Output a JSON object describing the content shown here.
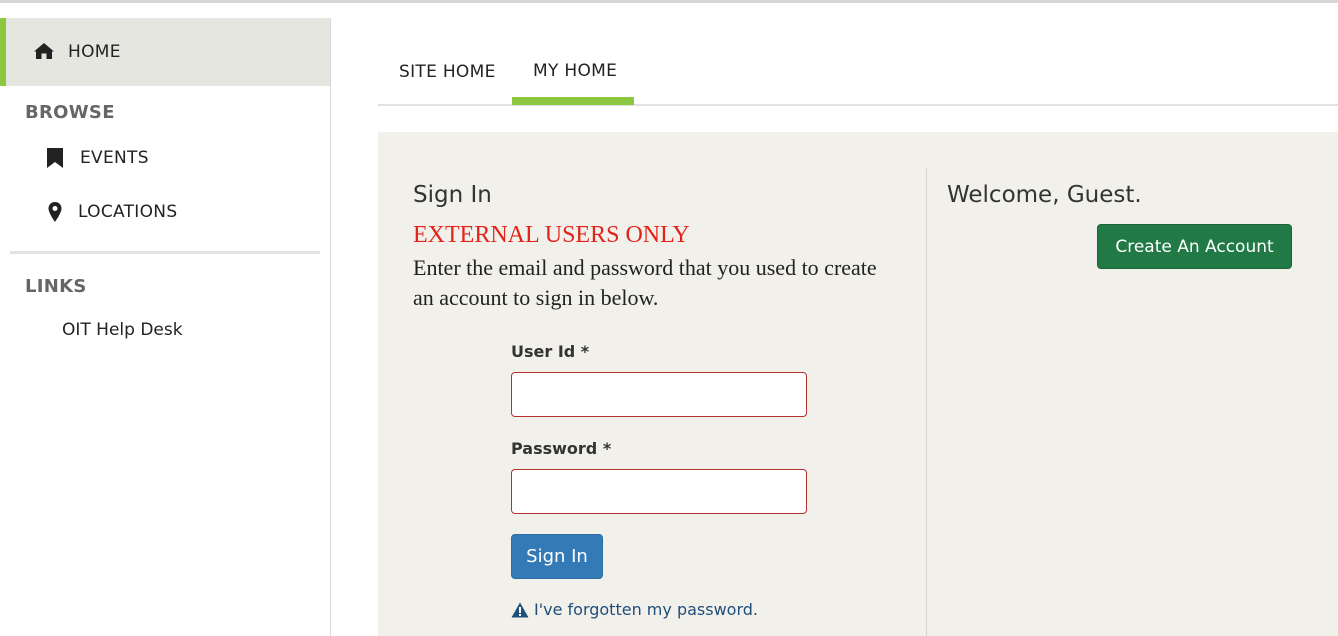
{
  "sidebar": {
    "home_label": "HOME",
    "browse_heading": "BROWSE",
    "items": [
      {
        "label": "EVENTS",
        "icon": "bookmark-icon"
      },
      {
        "label": "LOCATIONS",
        "icon": "map-pin-icon"
      }
    ],
    "links_heading": "LINKS",
    "links": [
      {
        "label": "OIT Help Desk"
      }
    ]
  },
  "tabs": [
    {
      "label": "SITE HOME",
      "active": false
    },
    {
      "label": "MY HOME",
      "active": true
    }
  ],
  "signin": {
    "title": "Sign In",
    "external_notice": "EXTERNAL USERS ONLY",
    "instructions": "Enter the email and password that you used to create an account to sign in below.",
    "user_id_label": "User Id *",
    "user_id_value": "",
    "password_label": "Password *",
    "password_value": "",
    "button_label": "Sign In",
    "forgot_label": "I've forgotten my password."
  },
  "welcome": {
    "text": "Welcome, Guest.",
    "create_account_label": "Create An Account"
  },
  "colors": {
    "accent_green": "#8dc63f",
    "primary_blue": "#337ab7",
    "success_green": "#217a45",
    "notice_red": "#e2231a"
  }
}
